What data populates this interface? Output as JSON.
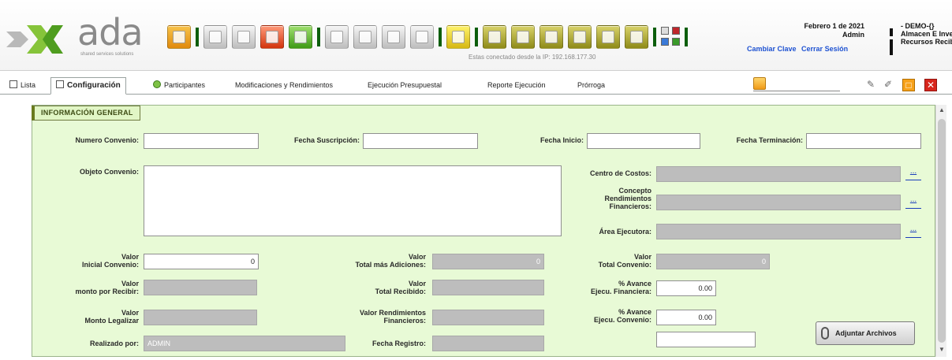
{
  "header": {
    "logo_text": "ada",
    "logo_tagline": "shared services solutions",
    "connection_text": "Estas conectado desde la IP: 192.168.177.30",
    "date": "Febrero 1 de 2021",
    "user": "Admin",
    "change_password": "Cambiar Clave",
    "logout": "Cerrar Sesión",
    "company": "- DEMO-{}",
    "warehouse": "Almacen E Inve",
    "resources": "Recursos Recib"
  },
  "tabs": [
    {
      "label": "Lista",
      "icon": "list-icon"
    },
    {
      "label": "Configuración",
      "icon": "document-icon"
    },
    {
      "label": "Participantes",
      "icon": "participants-icon"
    },
    {
      "label": "Modificaciones y Rendimientos"
    },
    {
      "label": "Ejecución Presupuestal"
    },
    {
      "label": "Reporte Ejecución"
    },
    {
      "label": "Prórroga"
    }
  ],
  "section_title": "INFORMACIÓN GENERAL",
  "form": {
    "numero_convenio": {
      "label": "Numero Convenio:",
      "value": ""
    },
    "fecha_suscripcion": {
      "label": "Fecha Suscripción:",
      "value": ""
    },
    "fecha_inicio": {
      "label": "Fecha Inicio:",
      "value": ""
    },
    "fecha_terminacion": {
      "label": "Fecha Terminación:",
      "value": ""
    },
    "objeto_convenio": {
      "label": "Objeto Convenio:",
      "value": ""
    },
    "centro_costos": {
      "label": "Centro de Costos:",
      "value": ""
    },
    "concepto_rendimientos": {
      "label1": "Concepto",
      "label2": "Rendimientos",
      "label3": "Financieros:",
      "value": ""
    },
    "area_ejecutora": {
      "label": "Área Ejecutora:",
      "value": ""
    },
    "valor_inicial": {
      "label1": "Valor",
      "label2": "Inicial Convenio:",
      "value": "0"
    },
    "valor_total_adiciones": {
      "label1": "Valor",
      "label2": "Total más Adiciones:",
      "value": "0"
    },
    "valor_total_convenio": {
      "label1": "Valor",
      "label2": "Total Convenio:",
      "value": "0"
    },
    "valor_monto_recibir": {
      "label1": "Valor",
      "label2": "monto por Recibir:",
      "value": ""
    },
    "valor_total_recibido": {
      "label1": "Valor",
      "label2": "Total Recibido:",
      "value": ""
    },
    "avance_financiera": {
      "label1": "% Avance",
      "label2": "Ejecu. Financiera:",
      "value": "0.00"
    },
    "valor_monto_legalizar": {
      "label1": "Valor",
      "label2": "Monto Legalizar",
      "value": ""
    },
    "valor_rendimientos": {
      "label1": "Valor Rendimientos",
      "label2": "Financieros:",
      "value": ""
    },
    "avance_convenio": {
      "label1": "% Avance",
      "label2": "Ejecu. Convenio:",
      "value": "0.00"
    },
    "realizado_por": {
      "label": "Realizado por:",
      "value": "ADMIN"
    },
    "fecha_registro": {
      "label": "Fecha Registro:",
      "value": ""
    },
    "extra_field": {
      "value": ""
    }
  },
  "ellipsis": "...",
  "attach_button": "Adjuntar Archivos",
  "colors": {
    "panel": "#e8fad6",
    "accent_green": "#0c5e0c",
    "link_blue": "#1e52d2",
    "disabled": "#bdbdbd"
  }
}
